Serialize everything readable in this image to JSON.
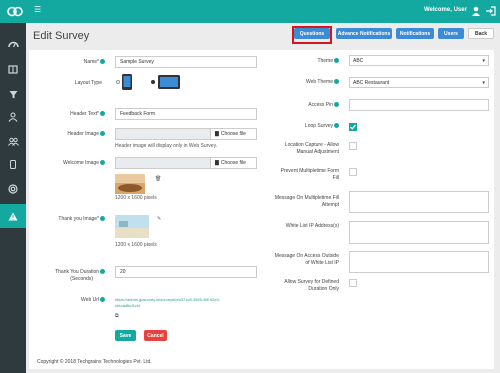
{
  "header": {
    "welcome": "Welcome, User"
  },
  "page": {
    "title": "Edit Survey"
  },
  "toolbar": {
    "questions": "Questions",
    "advance_notifications": "Advance Notifications",
    "notifications": "Notifications",
    "users": "Users",
    "back": "Back"
  },
  "form": {
    "name_label": "Name*",
    "name_value": "Sample Survey",
    "layout_label": "Layout Type",
    "header_text_label": "Header Text*",
    "header_text_value": "Feedback Form",
    "header_image_label": "Header Image",
    "choose_file": "Choose file",
    "header_image_note": "Header image will display only in Web Survey.",
    "welcome_image_label": "Welcome Image",
    "welcome_pixels": "1200 x 1600 pixels",
    "thankyou_image_label": "Thank you Image*",
    "thankyou_pixels": "1200 x 1600 pixels",
    "thankyou_duration_label": "Thank You Duration",
    "thankyou_duration_unit": "(Seconds)",
    "thankyou_duration_value": "20",
    "web_url_label": "Web Url",
    "web_url_line1": "https://admin.gosurvey.in/survey#/cfa371c8-3595-4fff-92e0-",
    "web_url_line2": "cbbda8bd1cf4",
    "theme_label": "Theme",
    "theme_value": "ABC",
    "web_theme_label": "Web Theme",
    "web_theme_value": "ABC Restaurant",
    "access_pin_label": "Access Pin",
    "loop_survey_label": "Loop Survey",
    "location_line1": "Location Capture - Allow",
    "location_line2": "Manual Adjustment",
    "prevent_line1": "Prevent Multipletime Form",
    "prevent_line2": "Fill",
    "message_multi_line1": "Message On Multipletime Fill",
    "message_multi_line2": "Attempt",
    "whitelist_label": "White List IP Address(s)",
    "message_access_line1": "Message On Access Outside",
    "message_access_line2": "of White List IP",
    "allow_line1": "Allow Survey for Defined",
    "allow_line2": "Duration Only",
    "loop_survey_checked": true
  },
  "actions": {
    "save": "Save",
    "cancel": "Cancel"
  },
  "footer": {
    "copyright": "Copyright © 2018 Techgrains Technologies Pvt. Ltd."
  },
  "colors": {
    "teal": "#13a9a0",
    "blue": "#3b8bd6",
    "red": "#e8423f",
    "sidebar": "#2f3a3f",
    "highlight": "#d9141b"
  }
}
